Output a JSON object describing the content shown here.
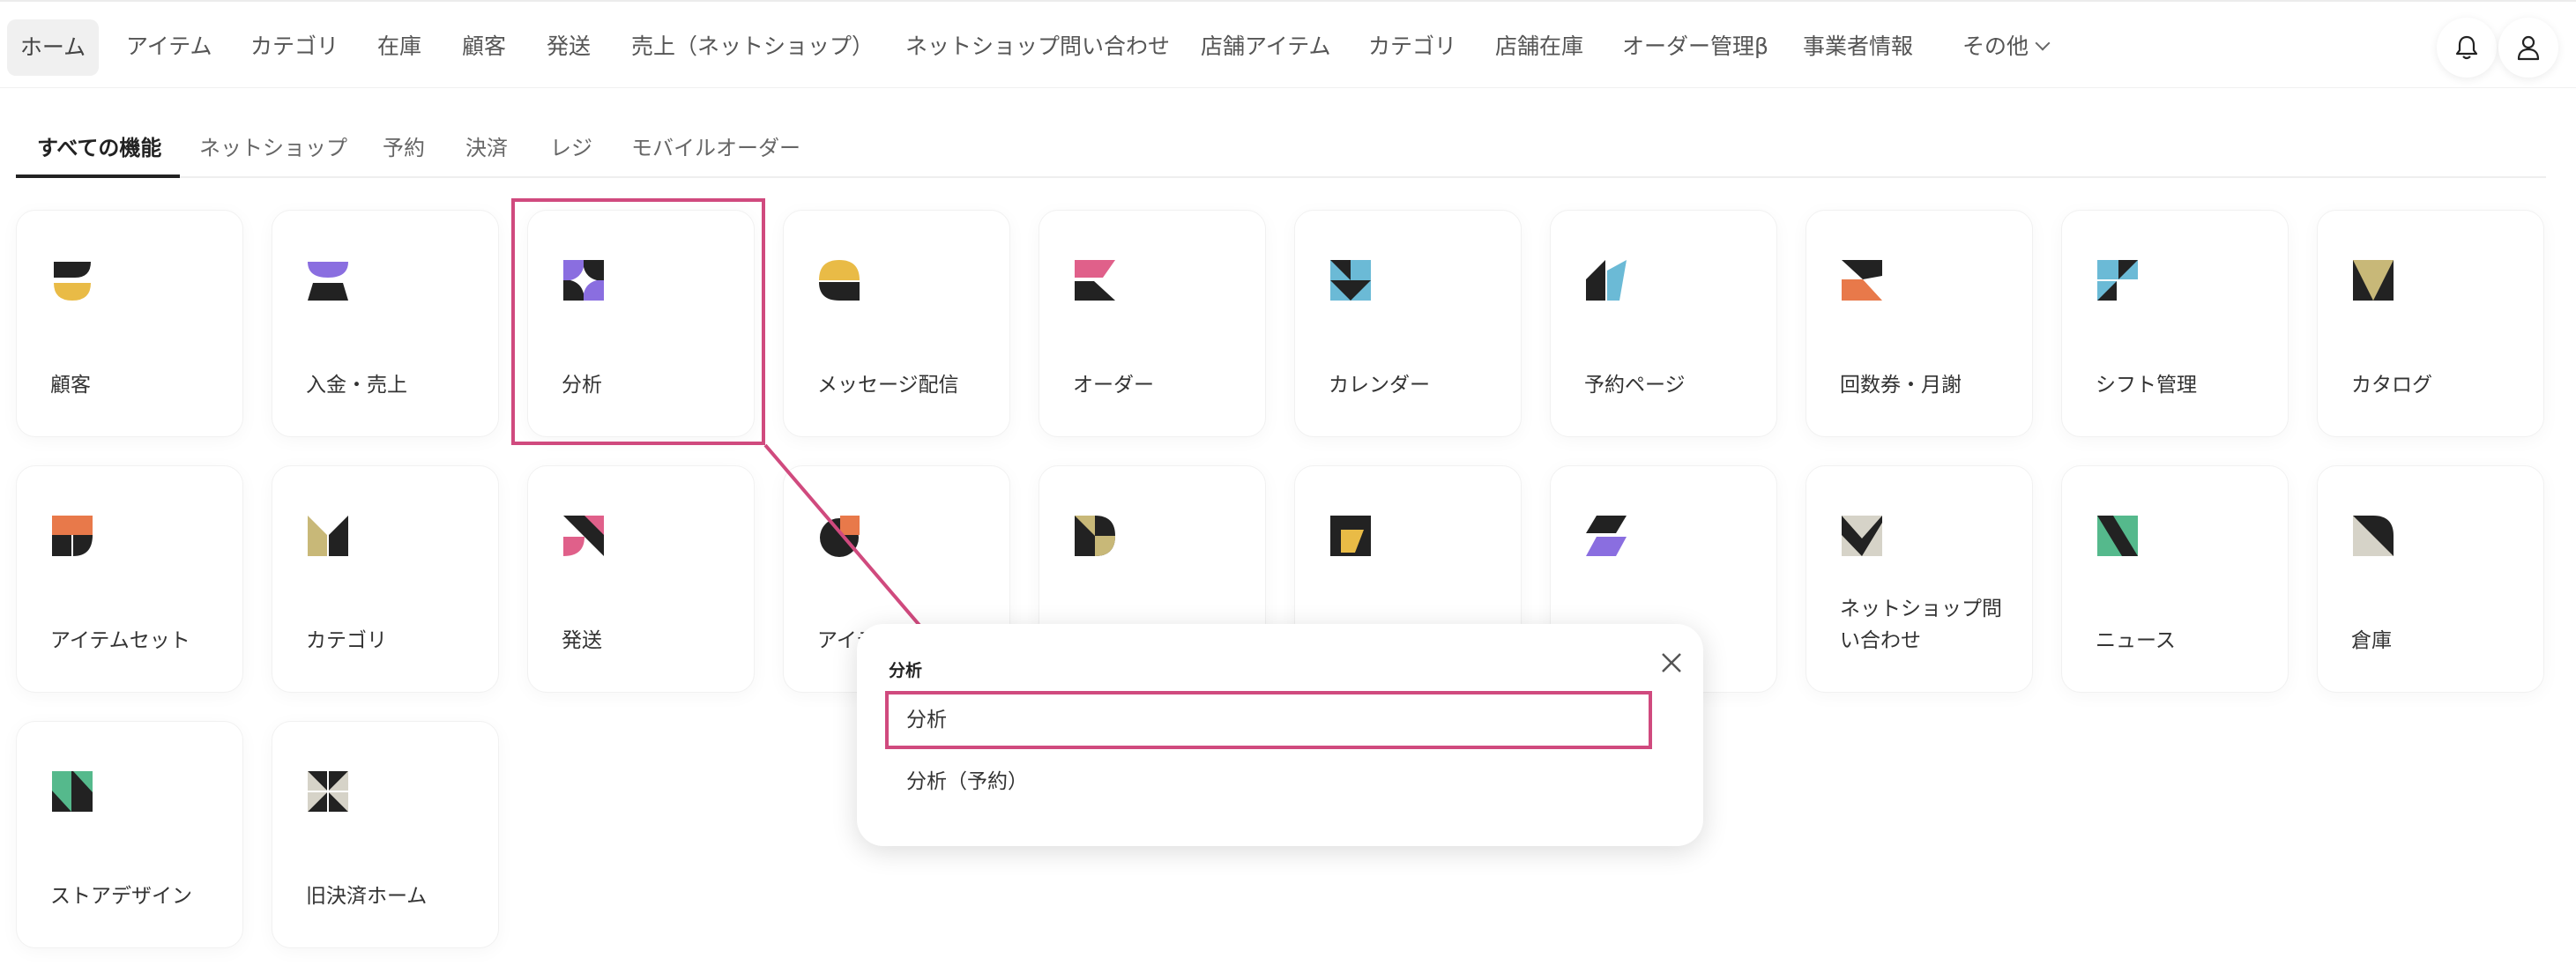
{
  "nav": {
    "items": [
      "ホーム",
      "アイテム",
      "カテゴリ",
      "在庫",
      "顧客",
      "発送",
      "売上（ネットショップ）",
      "ネットショップ問い合わせ",
      "店舗アイテム",
      "カテゴリ",
      "店舗在庫",
      "オーダー管理β",
      "事業者情報"
    ],
    "more_label": "その他"
  },
  "tabs": [
    "すべての機能",
    "ネットショップ",
    "予約",
    "決済",
    "レジ",
    "モバイルオーダー"
  ],
  "cards": [
    {
      "label": "顧客",
      "icon": "customer-icon"
    },
    {
      "label": "入金・売上",
      "icon": "payout-icon"
    },
    {
      "label": "分析",
      "icon": "analytics-icon"
    },
    {
      "label": "メッセージ配信",
      "icon": "message-icon"
    },
    {
      "label": "オーダー",
      "icon": "order-icon"
    },
    {
      "label": "カレンダー",
      "icon": "calendar-icon"
    },
    {
      "label": "予約ページ",
      "icon": "reservation-page-icon"
    },
    {
      "label": "回数券・月謝",
      "icon": "ticket-icon"
    },
    {
      "label": "シフト管理",
      "icon": "shift-icon"
    },
    {
      "label": "カタログ",
      "icon": "catalog-icon"
    },
    {
      "label": "アイテムセット",
      "icon": "item-set-icon"
    },
    {
      "label": "カテゴリ",
      "icon": "category-icon"
    },
    {
      "label": "発送",
      "icon": "shipping-icon"
    },
    {
      "label": "アイテ",
      "icon": "item-icon"
    },
    {
      "label": "",
      "icon": "app-icon-a"
    },
    {
      "label": "",
      "icon": "app-icon-b"
    },
    {
      "label": "",
      "icon": "app-icon-c"
    },
    {
      "label": "ネットショップ問い合わせ",
      "icon": "inquiry-icon"
    },
    {
      "label": "ニュース",
      "icon": "news-icon"
    },
    {
      "label": "倉庫",
      "icon": "warehouse-icon"
    },
    {
      "label": "ストアデザイン",
      "icon": "store-design-icon"
    },
    {
      "label": "旧決済ホーム",
      "icon": "legacy-payment-icon"
    }
  ],
  "popup": {
    "title": "分析",
    "items": [
      "分析",
      "分析（予約）"
    ]
  },
  "colors": {
    "highlight": "#d04a7e",
    "yellow": "#e9bb46",
    "purple": "#8a6ee0",
    "pink": "#e0608a",
    "blue": "#6bbad6",
    "orange": "#e8794a",
    "olive": "#c8b878",
    "green": "#55b98c",
    "gray": "#d6d3c8",
    "dark": "#222222"
  }
}
